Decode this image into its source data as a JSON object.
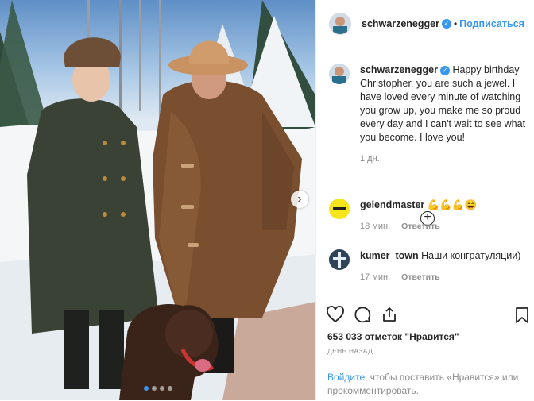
{
  "post": {
    "author": "schwarzenegger",
    "follow_label": "Подписаться",
    "separator": "•"
  },
  "caption": {
    "author": "schwarzenegger",
    "text": "Happy birthday Christopher, you are such a jewel. I have loved every minute of watching you grow up, you make me so proud every day and I can't wait to see what you become. I love you!",
    "age": "1 дн."
  },
  "comments": [
    {
      "user": "gelendmaster",
      "text": "💪💪💪😄",
      "age": "18 мин.",
      "reply_label": "Ответить"
    },
    {
      "user": "kumer_town",
      "text": "Наши конгратуляции)",
      "age": "17 мин.",
      "reply_label": "Ответить"
    }
  ],
  "icons": {
    "like": "heart-icon",
    "comment": "speech-bubble-icon",
    "share": "share-icon",
    "save": "bookmark-icon",
    "more_comments": "plus-circle-icon",
    "carousel_next": "chevron-right-icon"
  },
  "likes_text": "653 033 отметок \"Нравится\"",
  "date_text": "ДЕНЬ НАЗАД",
  "login": {
    "link": "Войдите",
    "rest": ", чтобы поставить «Нравится» или прокомментировать."
  },
  "colors": {
    "accent": "#3897f0",
    "muted": "#8e8e8e",
    "text": "#262626"
  },
  "carousel": {
    "slides": 4,
    "active": 1
  }
}
